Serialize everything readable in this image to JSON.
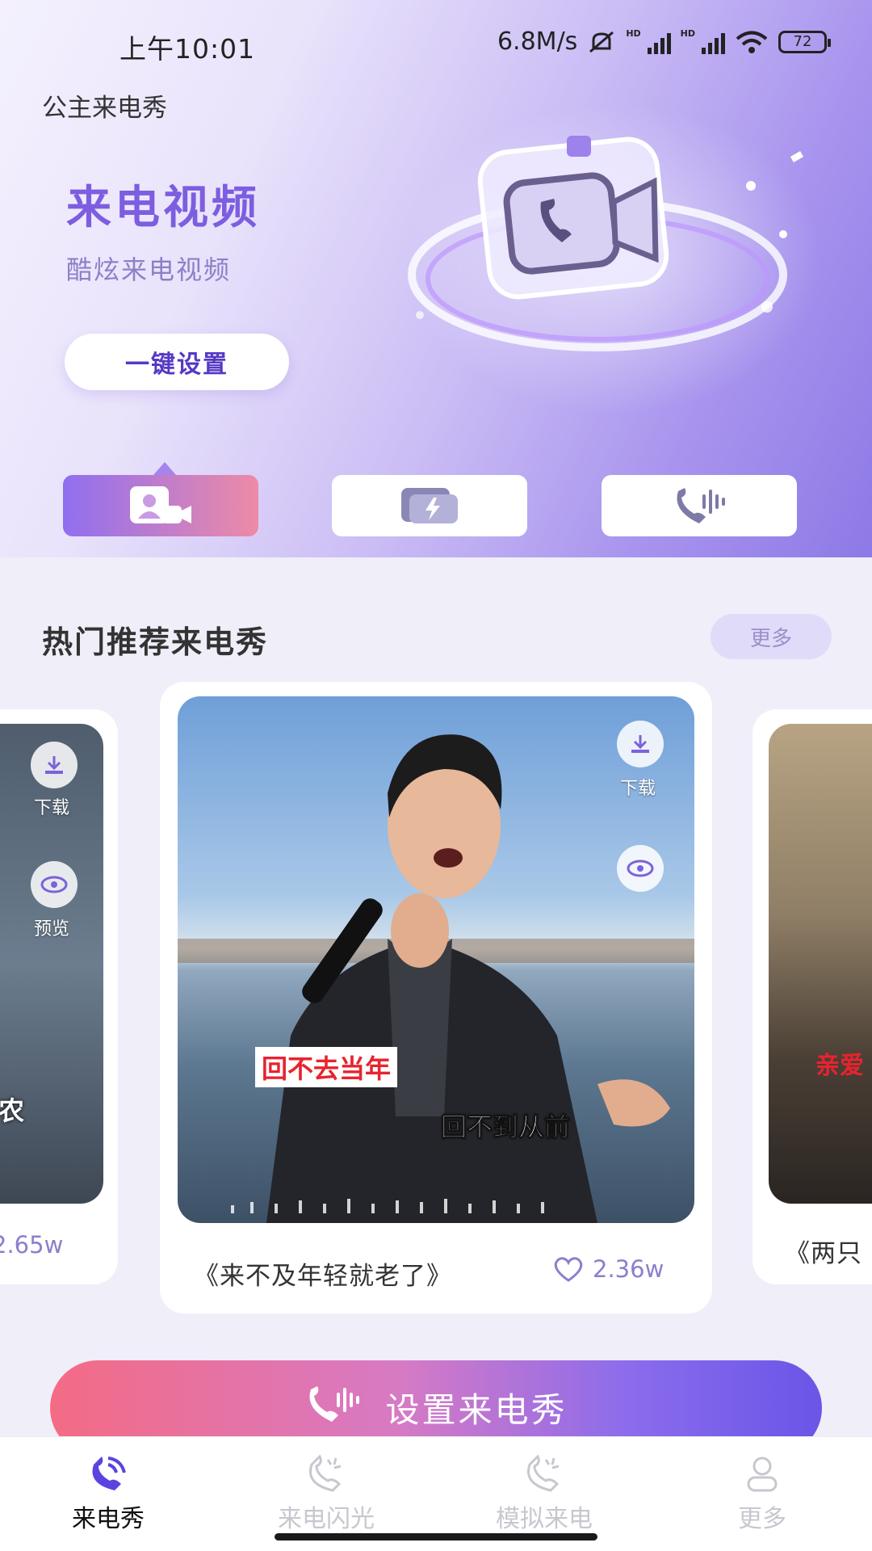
{
  "status_bar": {
    "time": "上午10:01",
    "net_speed": "6.8M/s",
    "hd1": "HD",
    "hd2": "HD",
    "battery": "72"
  },
  "app": {
    "title": "公主来电秀"
  },
  "hero": {
    "title": "来电视频",
    "subtitle": "酷炫来电视频",
    "button_label": "一键设置"
  },
  "feature_tabs": [
    {
      "icon": "video-contact-icon",
      "active": true
    },
    {
      "icon": "flash-photo-icon",
      "active": false
    },
    {
      "icon": "phone-voice-icon",
      "active": false
    }
  ],
  "section": {
    "title": "热门推荐来电秀",
    "more_label": "更多"
  },
  "cards": {
    "left": {
      "download_label": "下载",
      "preview_label": "预览",
      "likes": "2.65w",
      "caption": "农"
    },
    "center": {
      "download_label": "下载",
      "caption1": "回不去当年",
      "caption2": "回不到从前",
      "title": "《来不及年轻就老了》",
      "likes": "2.36w"
    },
    "right": {
      "caption": "亲爱",
      "title": "《两只"
    }
  },
  "cta": {
    "label": "设置来电秀"
  },
  "nav": [
    {
      "label": "来电秀",
      "icon": "call-show-icon",
      "active": true
    },
    {
      "label": "来电闪光",
      "icon": "call-flash-icon",
      "active": false
    },
    {
      "label": "模拟来电",
      "icon": "mock-call-icon",
      "active": false
    },
    {
      "label": "更多",
      "icon": "user-icon",
      "active": false
    }
  ],
  "colors": {
    "accent": "#7d5de0",
    "cta_start": "#f46b85",
    "cta_end": "#6a55e8",
    "like": "#8b7fcc"
  }
}
